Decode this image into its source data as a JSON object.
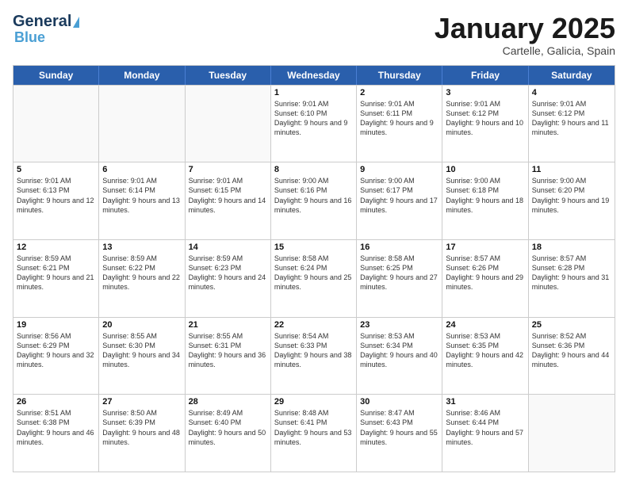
{
  "logo": {
    "line1": "General",
    "line2": "Blue"
  },
  "title": "January 2025",
  "subtitle": "Cartelle, Galicia, Spain",
  "days": [
    "Sunday",
    "Monday",
    "Tuesday",
    "Wednesday",
    "Thursday",
    "Friday",
    "Saturday"
  ],
  "weeks": [
    [
      {
        "day": "",
        "info": ""
      },
      {
        "day": "",
        "info": ""
      },
      {
        "day": "",
        "info": ""
      },
      {
        "day": "1",
        "info": "Sunrise: 9:01 AM\nSunset: 6:10 PM\nDaylight: 9 hours and 9 minutes."
      },
      {
        "day": "2",
        "info": "Sunrise: 9:01 AM\nSunset: 6:11 PM\nDaylight: 9 hours and 9 minutes."
      },
      {
        "day": "3",
        "info": "Sunrise: 9:01 AM\nSunset: 6:12 PM\nDaylight: 9 hours and 10 minutes."
      },
      {
        "day": "4",
        "info": "Sunrise: 9:01 AM\nSunset: 6:12 PM\nDaylight: 9 hours and 11 minutes."
      }
    ],
    [
      {
        "day": "5",
        "info": "Sunrise: 9:01 AM\nSunset: 6:13 PM\nDaylight: 9 hours and 12 minutes."
      },
      {
        "day": "6",
        "info": "Sunrise: 9:01 AM\nSunset: 6:14 PM\nDaylight: 9 hours and 13 minutes."
      },
      {
        "day": "7",
        "info": "Sunrise: 9:01 AM\nSunset: 6:15 PM\nDaylight: 9 hours and 14 minutes."
      },
      {
        "day": "8",
        "info": "Sunrise: 9:00 AM\nSunset: 6:16 PM\nDaylight: 9 hours and 16 minutes."
      },
      {
        "day": "9",
        "info": "Sunrise: 9:00 AM\nSunset: 6:17 PM\nDaylight: 9 hours and 17 minutes."
      },
      {
        "day": "10",
        "info": "Sunrise: 9:00 AM\nSunset: 6:18 PM\nDaylight: 9 hours and 18 minutes."
      },
      {
        "day": "11",
        "info": "Sunrise: 9:00 AM\nSunset: 6:20 PM\nDaylight: 9 hours and 19 minutes."
      }
    ],
    [
      {
        "day": "12",
        "info": "Sunrise: 8:59 AM\nSunset: 6:21 PM\nDaylight: 9 hours and 21 minutes."
      },
      {
        "day": "13",
        "info": "Sunrise: 8:59 AM\nSunset: 6:22 PM\nDaylight: 9 hours and 22 minutes."
      },
      {
        "day": "14",
        "info": "Sunrise: 8:59 AM\nSunset: 6:23 PM\nDaylight: 9 hours and 24 minutes."
      },
      {
        "day": "15",
        "info": "Sunrise: 8:58 AM\nSunset: 6:24 PM\nDaylight: 9 hours and 25 minutes."
      },
      {
        "day": "16",
        "info": "Sunrise: 8:58 AM\nSunset: 6:25 PM\nDaylight: 9 hours and 27 minutes."
      },
      {
        "day": "17",
        "info": "Sunrise: 8:57 AM\nSunset: 6:26 PM\nDaylight: 9 hours and 29 minutes."
      },
      {
        "day": "18",
        "info": "Sunrise: 8:57 AM\nSunset: 6:28 PM\nDaylight: 9 hours and 31 minutes."
      }
    ],
    [
      {
        "day": "19",
        "info": "Sunrise: 8:56 AM\nSunset: 6:29 PM\nDaylight: 9 hours and 32 minutes."
      },
      {
        "day": "20",
        "info": "Sunrise: 8:55 AM\nSunset: 6:30 PM\nDaylight: 9 hours and 34 minutes."
      },
      {
        "day": "21",
        "info": "Sunrise: 8:55 AM\nSunset: 6:31 PM\nDaylight: 9 hours and 36 minutes."
      },
      {
        "day": "22",
        "info": "Sunrise: 8:54 AM\nSunset: 6:33 PM\nDaylight: 9 hours and 38 minutes."
      },
      {
        "day": "23",
        "info": "Sunrise: 8:53 AM\nSunset: 6:34 PM\nDaylight: 9 hours and 40 minutes."
      },
      {
        "day": "24",
        "info": "Sunrise: 8:53 AM\nSunset: 6:35 PM\nDaylight: 9 hours and 42 minutes."
      },
      {
        "day": "25",
        "info": "Sunrise: 8:52 AM\nSunset: 6:36 PM\nDaylight: 9 hours and 44 minutes."
      }
    ],
    [
      {
        "day": "26",
        "info": "Sunrise: 8:51 AM\nSunset: 6:38 PM\nDaylight: 9 hours and 46 minutes."
      },
      {
        "day": "27",
        "info": "Sunrise: 8:50 AM\nSunset: 6:39 PM\nDaylight: 9 hours and 48 minutes."
      },
      {
        "day": "28",
        "info": "Sunrise: 8:49 AM\nSunset: 6:40 PM\nDaylight: 9 hours and 50 minutes."
      },
      {
        "day": "29",
        "info": "Sunrise: 8:48 AM\nSunset: 6:41 PM\nDaylight: 9 hours and 53 minutes."
      },
      {
        "day": "30",
        "info": "Sunrise: 8:47 AM\nSunset: 6:43 PM\nDaylight: 9 hours and 55 minutes."
      },
      {
        "day": "31",
        "info": "Sunrise: 8:46 AM\nSunset: 6:44 PM\nDaylight: 9 hours and 57 minutes."
      },
      {
        "day": "",
        "info": ""
      }
    ]
  ]
}
